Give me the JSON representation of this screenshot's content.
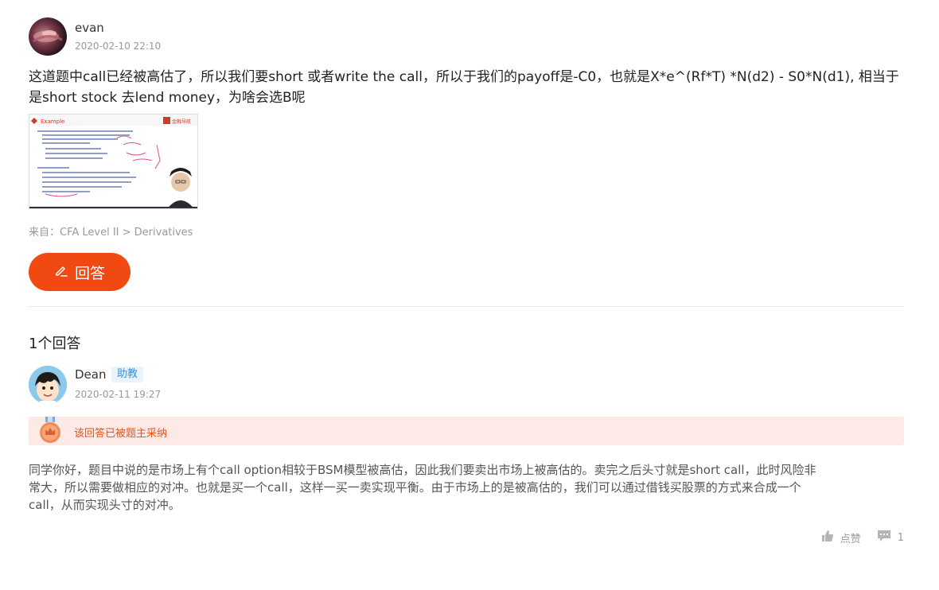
{
  "question": {
    "username": "evan",
    "time": "2020-02-10 22:10",
    "text": "这道题中call已经被高估了，所以我们要short 或者write the call，所以于我们的payoff是-C0，也就是X*e^(Rf*T) *N(d2) - S0*N(d1), 相当于是short stock 去lend money，为啥会选B呢",
    "image": {
      "slide_title": "Example",
      "brand": "金融导航"
    },
    "source": "来自：CFA Level II > Derivatives"
  },
  "answer_button_label": "回答",
  "answers_count": "1个回答",
  "answer": {
    "username": "Dean",
    "badge": "助教",
    "time": "2020-02-11 19:27",
    "accepted_text": "该回答已被题主采纳",
    "text": "同学你好，题目中说的是市场上有个call option相较于BSM模型被高估，因此我们要卖出市场上被高估的。卖完之后头寸就是short call，此时风险非常大，所以需要做相应的对冲。也就是买一个call，这样一买一卖实现平衡。由于市场上的是被高估的，我们可以通过借钱买股票的方式来合成一个call，从而实现头寸的对冲。",
    "like_label": "点赞",
    "comment_count": "1"
  },
  "colors": {
    "accent": "#f04912",
    "accepted_bg": "#fde9e6",
    "accepted_text": "#e0551e",
    "badge_text": "#3a8fd9"
  }
}
